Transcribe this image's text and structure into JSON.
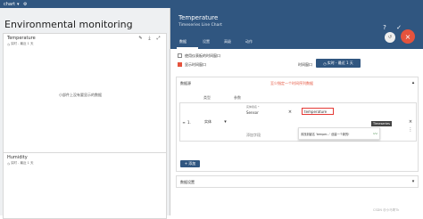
{
  "topbar": {
    "app_name": "chart",
    "brand": "",
    "right_label": ""
  },
  "left": {
    "title": "Environmental monitoring",
    "cards": [
      {
        "title": "Temperature",
        "subtitle": "实时 - 最近 1 天",
        "empty_msg": "小部件上没有要显示的数据"
      },
      {
        "title": "Humidity",
        "subtitle": "实时 - 最近 1 天"
      }
    ]
  },
  "panel": {
    "title": "Temperature",
    "subtitle": "Timeseries Line Chart",
    "tabs": [
      "数据",
      "设置",
      "高级",
      "动作"
    ],
    "checkbox1_label": "使用仪表板的时间窗口",
    "checkbox2_label": "显示时间窗口",
    "time_window_label": "时间窗口",
    "time_window_value": "实时 - 最近 1 天",
    "datasource_section": "数据源",
    "datasource_hint": "至少指定一个时间序列数据",
    "col_type": "类型",
    "col_param": "参数",
    "row_type_value": "实体",
    "entity_alias_label": "实体别名 *",
    "entity_alias_value": "Sensor",
    "key_input_value": "temperature",
    "tooltip_text": "Timeseries",
    "suggest_text": "未找到键名 'temper...' 创建一个新的!",
    "add_field": "添加字段",
    "add_button": "+ 添加",
    "data_settings": "数据设置",
    "watermark": "CSDN @小马哥Tk"
  },
  "colors": {
    "header": "#305680",
    "accent": "#e5533d",
    "highlight": "#e53935"
  }
}
